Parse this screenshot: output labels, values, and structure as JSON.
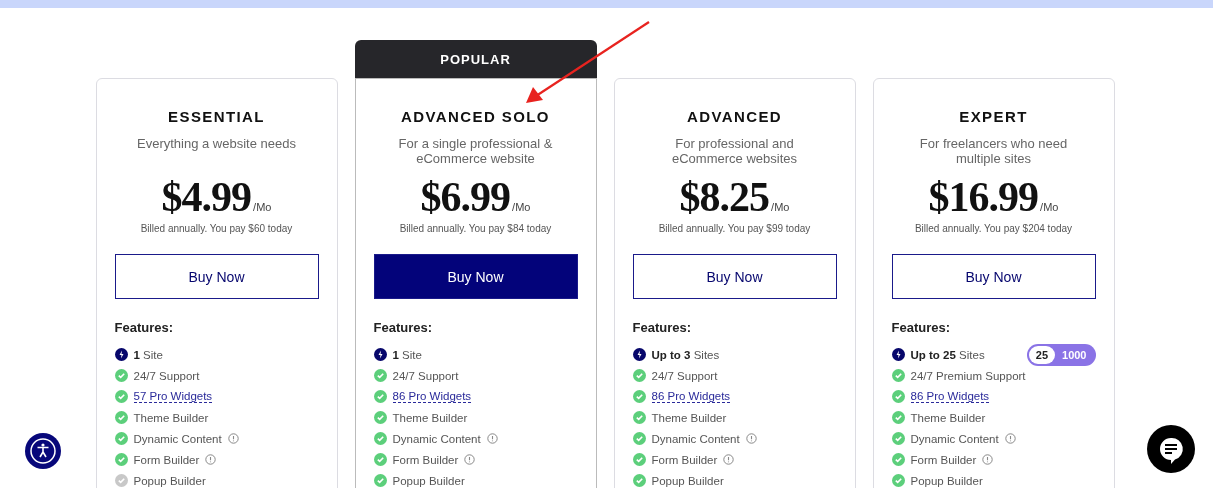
{
  "plans": [
    {
      "name": "ESSENTIAL",
      "tagline": "Everything a website needs",
      "price": "$4.99",
      "period": "/Mo",
      "billing": "Billed annually. You pay $60 today",
      "button": "Buy Now",
      "featured": false,
      "features_title": "Features:",
      "features": [
        {
          "kind": "site",
          "bold": "1",
          "text": "Site"
        },
        {
          "kind": "check",
          "text": "24/7 Support"
        },
        {
          "kind": "check",
          "text": "57 Pro Widgets",
          "link": true
        },
        {
          "kind": "check",
          "text": "Theme Builder"
        },
        {
          "kind": "check",
          "text": "Dynamic Content",
          "info": true
        },
        {
          "kind": "check",
          "text": "Form Builder",
          "info": true
        },
        {
          "kind": "excluded",
          "text": "Popup Builder"
        }
      ]
    },
    {
      "popular_label": "POPULAR",
      "name": "ADVANCED SOLO",
      "tagline": "For a single professional & eCommerce website",
      "price": "$6.99",
      "period": "/Mo",
      "billing": "Billed annually. You pay $84 today",
      "button": "Buy Now",
      "featured": true,
      "features_title": "Features:",
      "features": [
        {
          "kind": "site",
          "bold": "1",
          "text": "Site"
        },
        {
          "kind": "check",
          "text": "24/7 Support"
        },
        {
          "kind": "check",
          "text": "86 Pro Widgets",
          "link": true
        },
        {
          "kind": "check",
          "text": "Theme Builder"
        },
        {
          "kind": "check",
          "text": "Dynamic Content",
          "info": true
        },
        {
          "kind": "check",
          "text": "Form Builder",
          "info": true
        },
        {
          "kind": "check",
          "text": "Popup Builder"
        }
      ]
    },
    {
      "name": "ADVANCED",
      "tagline": "For professional and eCommerce websites",
      "price": "$8.25",
      "period": "/Mo",
      "billing": "Billed annually. You pay $99 today",
      "button": "Buy Now",
      "featured": false,
      "features_title": "Features:",
      "features": [
        {
          "kind": "site",
          "bold": "Up to 3",
          "text": "Sites"
        },
        {
          "kind": "check",
          "text": "24/7 Support"
        },
        {
          "kind": "check",
          "text": "86 Pro Widgets",
          "link": true
        },
        {
          "kind": "check",
          "text": "Theme Builder"
        },
        {
          "kind": "check",
          "text": "Dynamic Content",
          "info": true
        },
        {
          "kind": "check",
          "text": "Form Builder",
          "info": true
        },
        {
          "kind": "check",
          "text": "Popup Builder"
        }
      ]
    },
    {
      "name": "EXPERT",
      "tagline": "For freelancers who need multiple sites",
      "price": "$16.99",
      "period": "/Mo",
      "billing": "Billed annually. You pay $204 today",
      "button": "Buy Now",
      "featured": false,
      "features_title": "Features:",
      "features": [
        {
          "kind": "site",
          "bold": "Up to 25",
          "text": "Sites",
          "toggle": [
            {
              "label": "25",
              "selected": true
            },
            {
              "label": "1000",
              "selected": false
            }
          ]
        },
        {
          "kind": "check",
          "text": "24/7 Premium Support"
        },
        {
          "kind": "check",
          "text": "86 Pro Widgets",
          "link": true
        },
        {
          "kind": "check",
          "text": "Theme Builder"
        },
        {
          "kind": "check",
          "text": "Dynamic Content",
          "info": true
        },
        {
          "kind": "check",
          "text": "Form Builder",
          "info": true
        },
        {
          "kind": "check",
          "text": "Popup Builder"
        }
      ]
    }
  ]
}
